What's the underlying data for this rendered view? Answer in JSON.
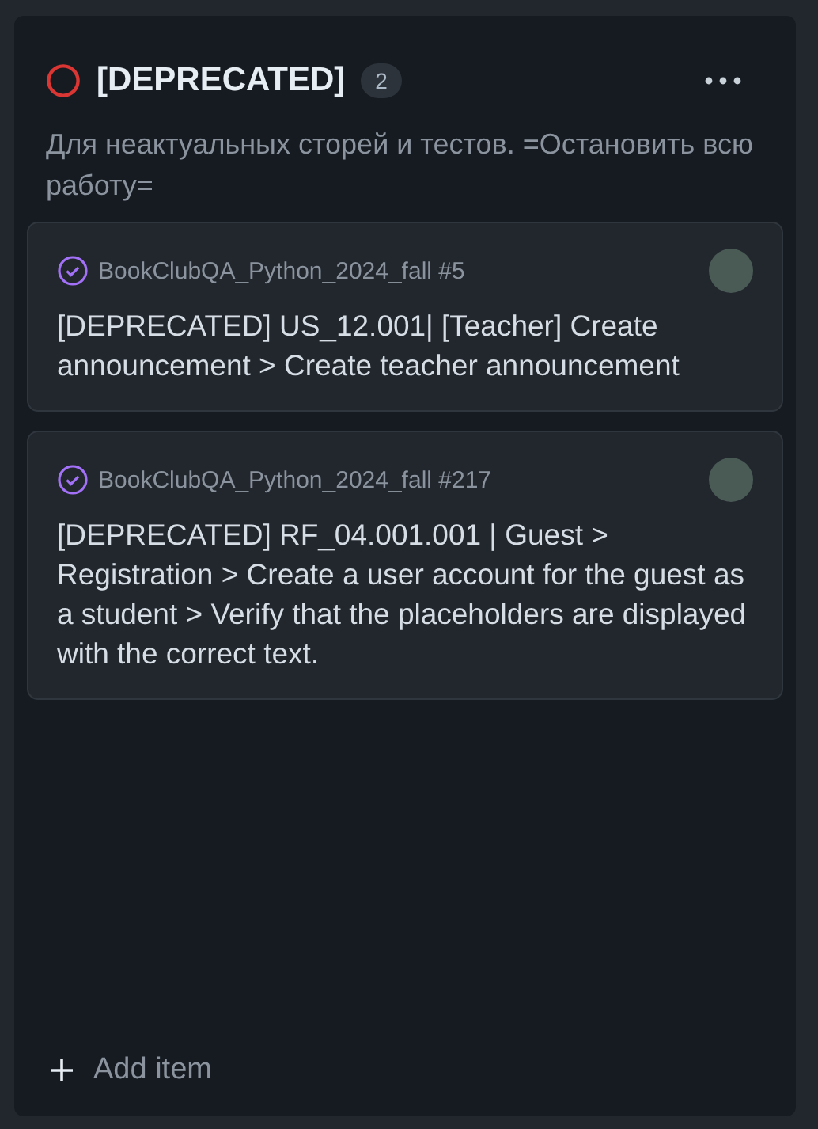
{
  "column": {
    "title": "[DEPRECATED]",
    "count": "2",
    "description": "Для неактуальных сторей и тестов. =Остановить всю работу="
  },
  "cards": [
    {
      "repository": "BookClubQA_Python_2024_fall #5",
      "title": "[DEPRECATED] US_12.001| [Teacher] Create announcement > Create teacher announcement"
    },
    {
      "repository": "BookClubQA_Python_2024_fall #217",
      "title": "[DEPRECATED] RF_04.001.001 | Guest > Registration > Create a user account for the guest as a student > Verify that the placeholders are displayed with the correct text."
    }
  ],
  "add_item": "Add item"
}
